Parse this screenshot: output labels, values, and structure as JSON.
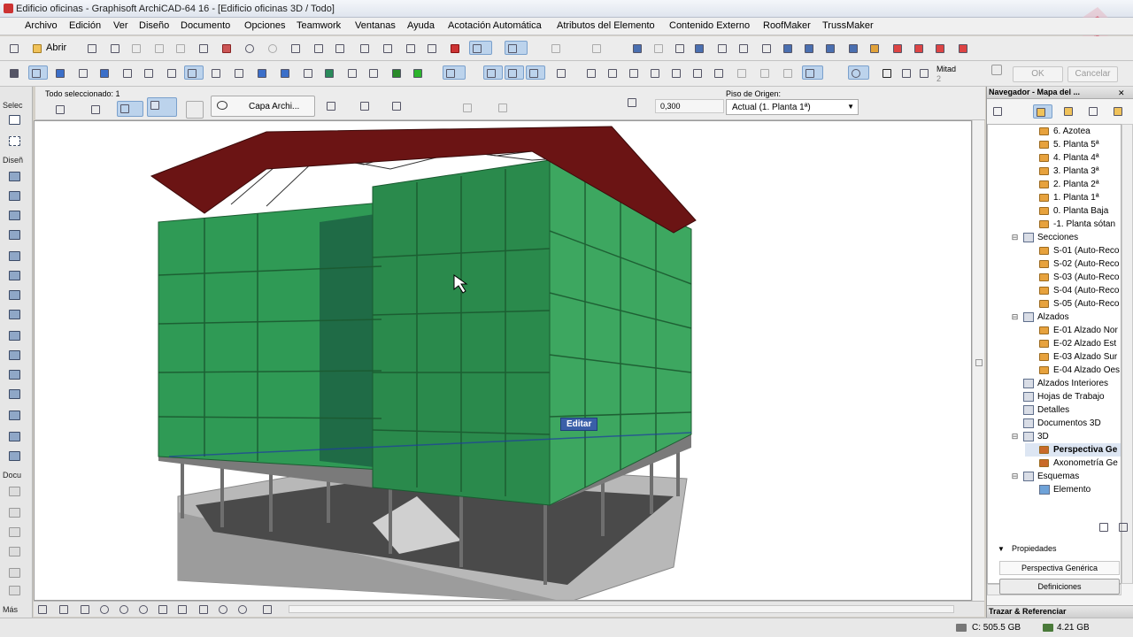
{
  "window": {
    "title": "Edificio oficinas - Graphisoft ArchiCAD-64 16 - [Edificio oficinas 3D / Todo]"
  },
  "menu": [
    "Archivo",
    "Edición",
    "Ver",
    "Diseño",
    "Documento",
    "Opciones",
    "Teamwork",
    "Ventanas",
    "Ayuda",
    "Acotación Automática",
    "Atributos del Elemento",
    "Contenido Externo",
    "RoofMaker",
    "TrussMaker"
  ],
  "toolbar": {
    "open_label": "Abrir",
    "ok_label": "OK",
    "cancel_label": "Cancelar",
    "mitad_label": "Mitad",
    "mitad_value": "2"
  },
  "infobox": {
    "selection": "Todo seleccionado: 1",
    "layer": "Capa Archi...",
    "value": "0,300",
    "floor_label": "Piso de Origen:",
    "floor_value": "Actual (1. Planta 1ª)"
  },
  "toolbox": {
    "select": "Selec",
    "design": "Diseñ",
    "document": "Docu",
    "more": "Más"
  },
  "viewport": {
    "tooltip": "Editar"
  },
  "navigator": {
    "title": "Navegador - Mapa del ...",
    "tree": [
      {
        "label": "6. Azotea",
        "icon": "story-icon"
      },
      {
        "label": "5. Planta 5ª",
        "icon": "story-icon"
      },
      {
        "label": "4. Planta 4ª",
        "icon": "story-icon"
      },
      {
        "label": "3. Planta 3ª",
        "icon": "story-icon"
      },
      {
        "label": "2. Planta 2ª",
        "icon": "story-icon"
      },
      {
        "label": "1. Planta 1ª",
        "icon": "story-icon"
      },
      {
        "label": "0. Planta Baja",
        "icon": "story-icon"
      },
      {
        "label": "-1. Planta sótan",
        "icon": "story-icon"
      },
      {
        "label": "Secciones",
        "icon": "section-icon"
      },
      {
        "label": "S-01 (Auto-Reco",
        "icon": "section-item-icon"
      },
      {
        "label": "S-02 (Auto-Reco",
        "icon": "section-item-icon"
      },
      {
        "label": "S-03 (Auto-Reco",
        "icon": "section-item-icon"
      },
      {
        "label": "S-04 (Auto-Reco",
        "icon": "section-item-icon"
      },
      {
        "label": "S-05 (Auto-Reco",
        "icon": "section-item-icon"
      },
      {
        "label": "Alzados",
        "icon": "elevation-icon"
      },
      {
        "label": "E-01 Alzado Nor",
        "icon": "elevation-item-icon"
      },
      {
        "label": "E-02 Alzado Est",
        "icon": "elevation-item-icon"
      },
      {
        "label": "E-03 Alzado Sur",
        "icon": "elevation-item-icon"
      },
      {
        "label": "E-04 Alzado Oes",
        "icon": "elevation-item-icon"
      },
      {
        "label": "Alzados Interiores",
        "icon": "interior-elevation-icon"
      },
      {
        "label": "Hojas de Trabajo",
        "icon": "worksheet-icon"
      },
      {
        "label": "Detalles",
        "icon": "detail-icon"
      },
      {
        "label": "Documentos 3D",
        "icon": "document-3d-icon"
      },
      {
        "label": "3D",
        "icon": "3d-icon"
      },
      {
        "label": "Perspectiva Ge",
        "icon": "perspective-icon"
      },
      {
        "label": "Axonometría Ge",
        "icon": "axonometry-icon"
      },
      {
        "label": "Esquemas",
        "icon": "schedule-icon"
      },
      {
        "label": "Elemento",
        "icon": "element-icon"
      }
    ],
    "properties_label": "Propiedades",
    "properties_value": "Perspectiva Genérica",
    "definitions_button": "Definiciones",
    "footer": "Trazar & Referenciar"
  },
  "status": {
    "disk": "C: 505.5 GB",
    "memory": "4.21 GB"
  }
}
